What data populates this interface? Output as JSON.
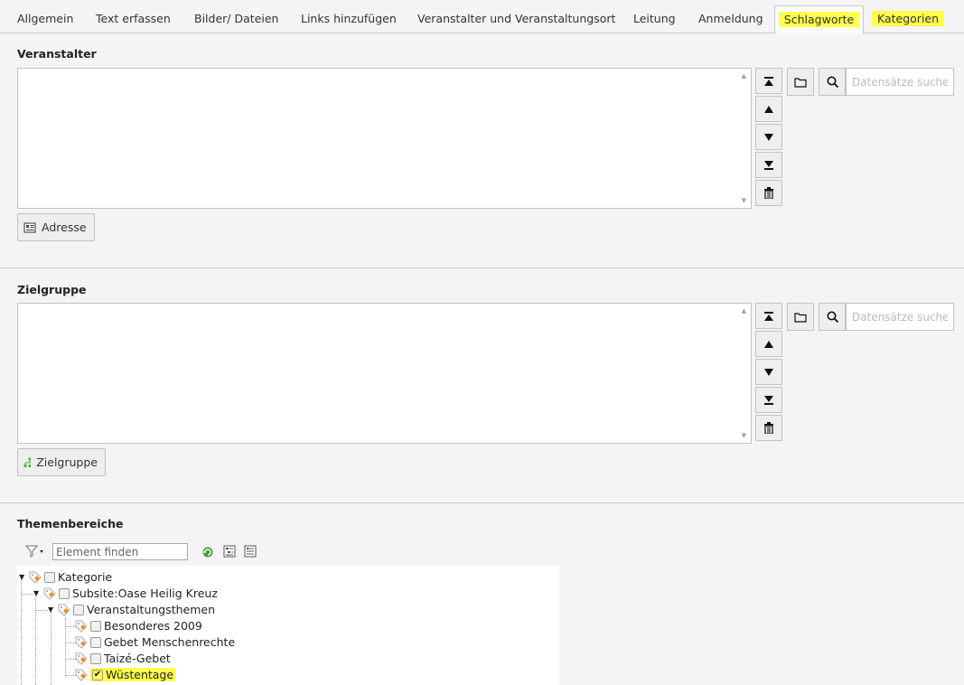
{
  "tabs": [
    {
      "label": "Allgemein"
    },
    {
      "label": "Text erfassen"
    },
    {
      "label": "Bilder/ Dateien"
    },
    {
      "label": "Links hinzufügen"
    },
    {
      "label": "Veranstalter und Veranstaltungsort"
    },
    {
      "label": "Leitung"
    },
    {
      "label": "Anmeldung"
    },
    {
      "label": "Schlagworte"
    },
    {
      "label": "Kategorien"
    }
  ],
  "active_tab": "Schlagworte",
  "colors": {
    "highlight": "#ffff4d",
    "active_icon": "#4a9a3a",
    "tag_orange": "#f08c28"
  },
  "veranstalter": {
    "title": "Veranstalter",
    "search_placeholder": "Datensätze suchen",
    "button_label": "Adresse"
  },
  "zielgruppe": {
    "title": "Zielgruppe",
    "search_placeholder": "Datensätze suchen",
    "button_label": "Zielgruppe"
  },
  "themen": {
    "title": "Themenbereiche",
    "filter_placeholder": "Element finden",
    "tree": [
      {
        "label": "Kategorie",
        "checked": false
      },
      {
        "label": "Subsite:Oase Heilig Kreuz",
        "checked": false
      },
      {
        "label": "Veranstaltungsthemen",
        "checked": false
      },
      {
        "label": "Besonderes 2009",
        "checked": false
      },
      {
        "label": "Gebet Menschenrechte",
        "checked": false
      },
      {
        "label": "Taizé-Gebet",
        "checked": false
      },
      {
        "label": "Wüstentage",
        "checked": true
      }
    ]
  }
}
